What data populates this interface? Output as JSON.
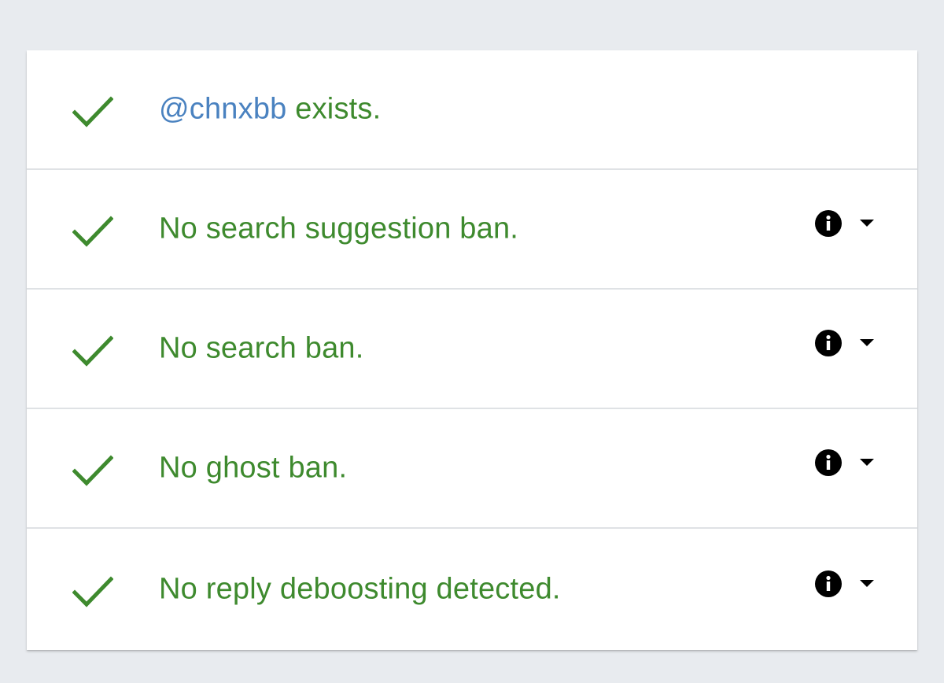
{
  "results": {
    "items": [
      {
        "handle": "@chnxbb",
        "text": " exists.",
        "has_details": false,
        "status_icon": "check-icon"
      },
      {
        "handle": "",
        "text": "No search suggestion ban.",
        "has_details": true,
        "status_icon": "check-icon"
      },
      {
        "handle": "",
        "text": "No search ban.",
        "has_details": true,
        "status_icon": "check-icon"
      },
      {
        "handle": "",
        "text": "No ghost ban.",
        "has_details": true,
        "status_icon": "check-icon"
      },
      {
        "handle": "",
        "text": "No reply deboosting detected.",
        "has_details": true,
        "status_icon": "check-icon"
      }
    ]
  },
  "colors": {
    "success_green": "#3e8a2e",
    "handle_blue": "#4a82c0",
    "background": "#e8ebef",
    "card": "#ffffff",
    "divider": "#dfe2e5"
  },
  "icons": {
    "status": "check-icon",
    "details": "info-icon",
    "expand": "caret-down-icon"
  }
}
